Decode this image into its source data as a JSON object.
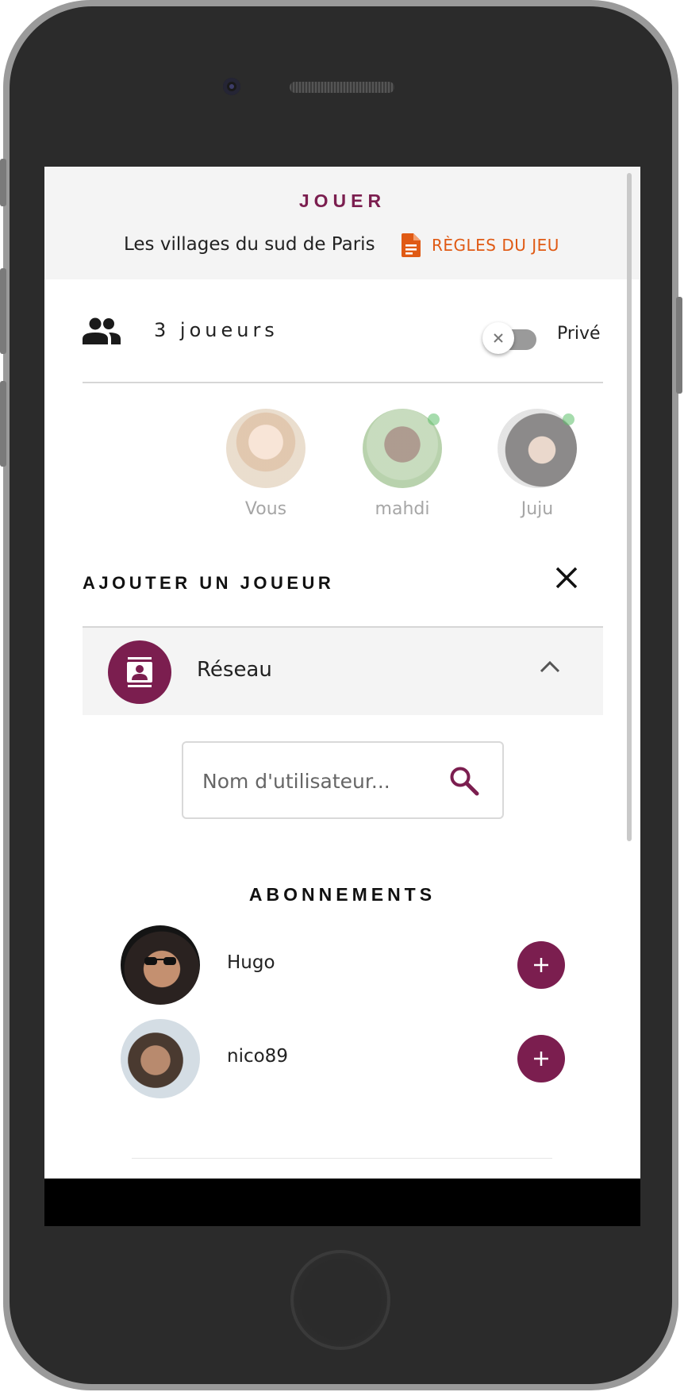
{
  "header": {
    "title": "JOUER",
    "subtitle": "Les villages du sud de Paris",
    "rules_label": "RÈGLES DU JEU",
    "rules_icon": "document-icon"
  },
  "players": {
    "count_label": "3 joueurs",
    "icon": "group-icon",
    "private_label": "Privé",
    "private_enabled": false,
    "list": [
      {
        "name": "Vous",
        "online": false
      },
      {
        "name": "mahdi",
        "online": true
      },
      {
        "name": "Juju",
        "online": true
      }
    ]
  },
  "add_player": {
    "title": "AJOUTER UN JOUEUR",
    "source_label": "Réseau",
    "search_placeholder": "Nom d'utilisateur..."
  },
  "subscriptions": {
    "title": "ABONNEMENTS",
    "items": [
      {
        "name": "Hugo"
      },
      {
        "name": "nico89"
      }
    ]
  },
  "colors": {
    "brand": "#7b1e4f",
    "accent": "#e05a14",
    "online": "#5cc06a"
  }
}
